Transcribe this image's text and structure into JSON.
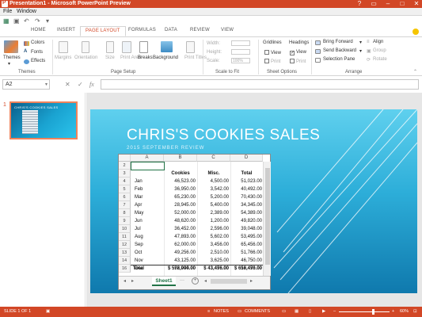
{
  "window": {
    "title": "Presentation1 - Microsoft PowerPoint Preview",
    "controls": [
      "?",
      "▭",
      "–",
      "□",
      "✕"
    ]
  },
  "menu": {
    "file": "File",
    "window": "Window"
  },
  "ribbon_tabs": [
    "HOME",
    "INSERT",
    "PAGE LAYOUT",
    "FORMULAS",
    "DATA",
    "REVIEW",
    "VIEW"
  ],
  "active_tab": "PAGE LAYOUT",
  "ribbon": {
    "themes": {
      "themes": "Themes",
      "colors": "Colors",
      "fonts": "Fonts",
      "effects": "Effects",
      "group": "Themes"
    },
    "page_setup": {
      "margins": "Margins",
      "orientation": "Orientation",
      "size": "Size",
      "print_area": "Print Area",
      "breaks": "Breaks",
      "background": "Background",
      "print_titles": "Print Titles",
      "group": "Page Setup"
    },
    "scale": {
      "width": "Width:",
      "height": "Height:",
      "scale": "Scale:",
      "scale_value": "100%",
      "group": "Scale to Fit"
    },
    "sheet_options": {
      "gridlines": "Gridlines",
      "headings": "Headings",
      "view": "View",
      "print": "Print",
      "group": "Sheet Options"
    },
    "arrange": {
      "bring_forward": "Bring Forward",
      "send_backward": "Send Backward",
      "selection_pane": "Selection Pane",
      "align": "Align",
      "group_btn": "Group",
      "rotate": "Rotate",
      "group": "Arrange"
    }
  },
  "formula_bar": {
    "name_box": "A2",
    "fx": "fx",
    "cancel": "✕",
    "enter": "✓"
  },
  "thumbnail": {
    "number": "1",
    "title": "CHRIS'S COOKIES SALES"
  },
  "slide": {
    "title": "CHRIS'S COOKIES SALES",
    "subtitle": "2015 SEPTEMBER REVIEW"
  },
  "sheet": {
    "columns": [
      "A",
      "B",
      "C",
      "D"
    ],
    "header_row": {
      "row": "3",
      "cookies": "Cookies",
      "misc": "Misc.",
      "total": "Total"
    },
    "rows": [
      {
        "n": "4",
        "month": "Jan",
        "cookies": "46,523.00",
        "misc": "4,500.00",
        "total": "51,023.00"
      },
      {
        "n": "5",
        "month": "Feb",
        "cookies": "36,950.00",
        "misc": "3,542.00",
        "total": "40,492.00"
      },
      {
        "n": "6",
        "month": "Mar",
        "cookies": "65,230.00",
        "misc": "5,200.00",
        "total": "70,430.00"
      },
      {
        "n": "7",
        "month": "Apr",
        "cookies": "28,945.00",
        "misc": "5,400.00",
        "total": "34,345.00"
      },
      {
        "n": "8",
        "month": "May",
        "cookies": "52,000.00",
        "misc": "2,389.00",
        "total": "54,389.00"
      },
      {
        "n": "9",
        "month": "Jun",
        "cookies": "48,620.00",
        "misc": "1,200.00",
        "total": "49,820.00"
      },
      {
        "n": "10",
        "month": "Jul",
        "cookies": "36,452.00",
        "misc": "2,596.00",
        "total": "39,048.00"
      },
      {
        "n": "11",
        "month": "Aug",
        "cookies": "47,893.00",
        "misc": "5,602.00",
        "total": "53,495.00"
      },
      {
        "n": "12",
        "month": "Sep",
        "cookies": "62,000.00",
        "misc": "3,456.00",
        "total": "65,456.00"
      },
      {
        "n": "13",
        "month": "Oct",
        "cookies": "49,256.00",
        "misc": "2,510.00",
        "total": "51,766.00"
      },
      {
        "n": "14",
        "month": "Nov",
        "cookies": "43,125.00",
        "misc": "3,625.00",
        "total": "46,750.00"
      },
      {
        "n": "15",
        "month": "Dec",
        "cookies": "56,000.00",
        "misc": "3,456.00",
        "total": "59,456.00"
      }
    ],
    "total_row": {
      "n": "16",
      "label": "Total",
      "cookies": "$ 572,994.00",
      "misc": "$ 43,476.00",
      "total": "$ 616,470.00"
    },
    "row2": "2",
    "sheet_tab": "Sheet1",
    "ghost_row": {
      "cookies": "572,994.00",
      "misc": "43,476.00",
      "total": "616,470.00"
    }
  },
  "status": {
    "slide": "SLIDE 1 OF 1",
    "notes": "NOTES",
    "comments": "COMMENTS",
    "zoom": "60%"
  }
}
